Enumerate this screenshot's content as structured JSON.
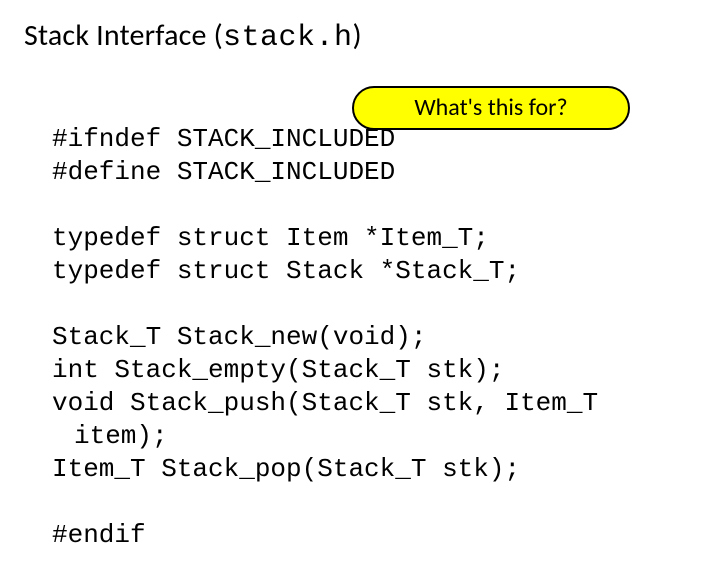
{
  "title": {
    "prefix": "Stack Interface (",
    "mono": "stack.h",
    "suffix": ")"
  },
  "callout": {
    "text": "What's this for?"
  },
  "code": {
    "l1": "#ifndef STACK_INCLUDED",
    "l2": "#define STACK_INCLUDED",
    "l3": "",
    "l4": "typedef struct Item *Item_T;",
    "l5": "typedef struct Stack *Stack_T;",
    "l6": "",
    "l7": "Stack_T Stack_new(void);",
    "l8": "int Stack_empty(Stack_T stk);",
    "l9": "void Stack_push(Stack_T stk, Item_T",
    "l10": "item);",
    "l11": "Item_T Stack_pop(Stack_T stk);",
    "l12": "",
    "l13": "#endif"
  }
}
